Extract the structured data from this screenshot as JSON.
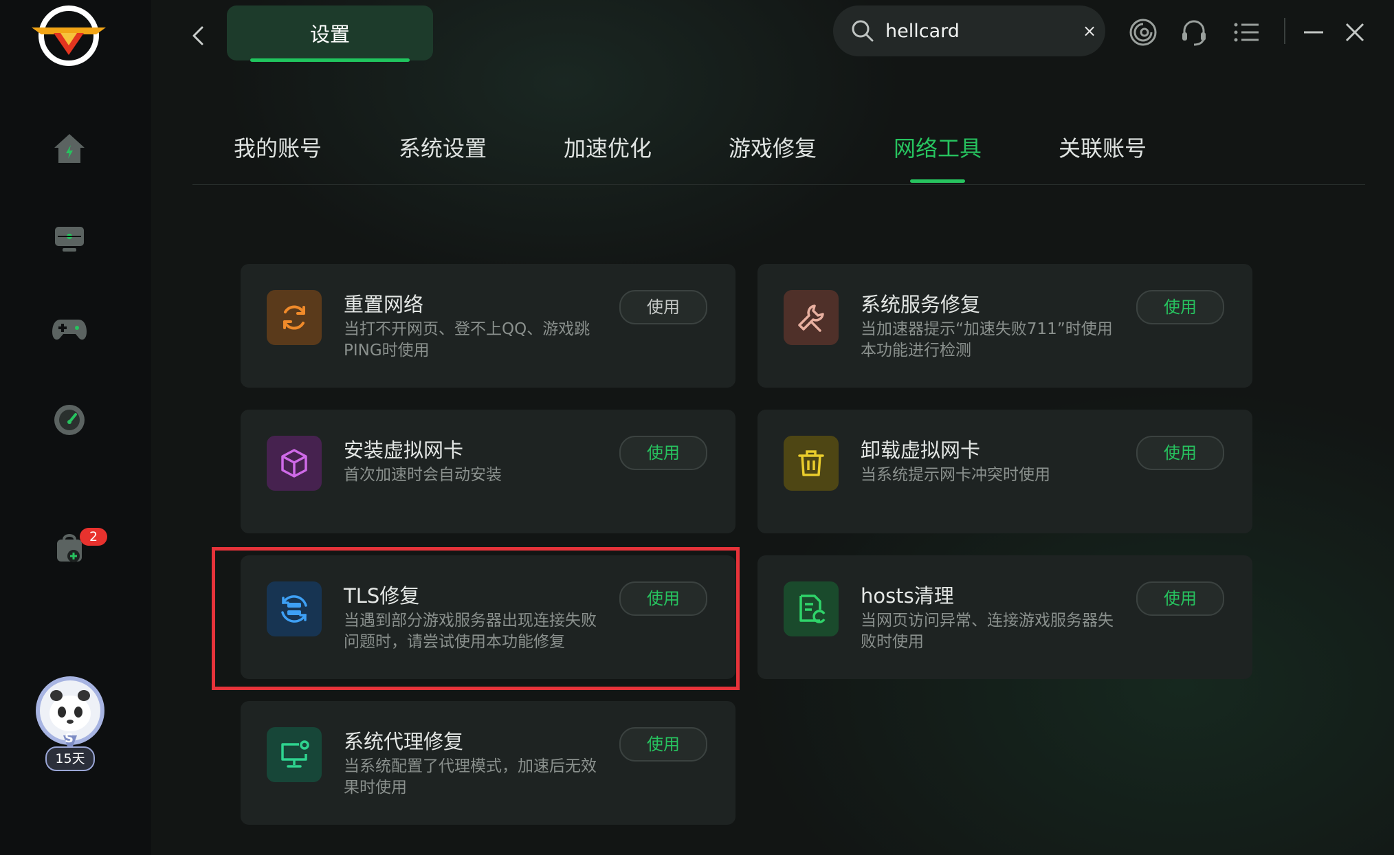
{
  "header": {
    "title_tab": "设置",
    "search": {
      "value": "hellcard",
      "clear_label": "×"
    }
  },
  "tabs": [
    {
      "label": "我的账号"
    },
    {
      "label": "系统设置"
    },
    {
      "label": "加速优化"
    },
    {
      "label": "游戏修复"
    },
    {
      "label": "网络工具",
      "active": true
    },
    {
      "label": "关联账号"
    }
  ],
  "sidebar": {
    "items": [
      {
        "icon": "home-icon"
      },
      {
        "icon": "monitor-icon"
      },
      {
        "icon": "gamepad-icon"
      },
      {
        "icon": "speedometer-icon"
      },
      {
        "icon": "bag-icon",
        "badge": "2"
      }
    ],
    "avatar": {
      "level_letter": "S",
      "days": "15天"
    }
  },
  "tools": [
    {
      "title": "重置网络",
      "desc": "当打不开网页、登不上QQ、游戏跳PING时使用",
      "button": "使用",
      "icon": "refresh-icon",
      "icon_color": "#f08a2a",
      "icon_bg": "#5a3a1b"
    },
    {
      "title": "系统服务修复",
      "desc": "当加速器提示“加速失败711”时使用本功能进行检测",
      "button": "使用",
      "icon": "wrench-icon",
      "icon_color": "#e8b0a0",
      "icon_bg": "#4f3029"
    },
    {
      "title": "安装虚拟网卡",
      "desc": "首次加速时会自动安装",
      "button": "使用",
      "icon": "cube-icon",
      "icon_color": "#cf6ae8",
      "icon_bg": "#46224f"
    },
    {
      "title": "卸载虚拟网卡",
      "desc": "当系统提示网卡冲突时使用",
      "button": "使用",
      "icon": "trash-icon",
      "icon_color": "#eacd2c",
      "icon_bg": "#4e4614"
    },
    {
      "title": "TLS修复",
      "desc": "当遇到部分游戏服务器出现连接失败问题时，请尝试使用本功能修复",
      "button": "使用",
      "icon": "server-refresh-icon",
      "icon_color": "#3ea0f5",
      "icon_bg": "#173452"
    },
    {
      "title": "hosts清理",
      "desc": "当网页访问异常、连接游戏服务器失败时使用",
      "button": "使用",
      "icon": "file-clean-icon",
      "icon_color": "#2fd46a",
      "icon_bg": "#1a4a2c"
    },
    {
      "title": "系统代理修复",
      "desc": "当系统配置了代理模式，加速后无效果时使用",
      "button": "使用",
      "icon": "monitor-gear-icon",
      "icon_color": "#2fd48f",
      "icon_bg": "#174638"
    }
  ],
  "colors": {
    "accent": "#27c35f",
    "highlight": "#e7333a",
    "background": "#121514"
  }
}
